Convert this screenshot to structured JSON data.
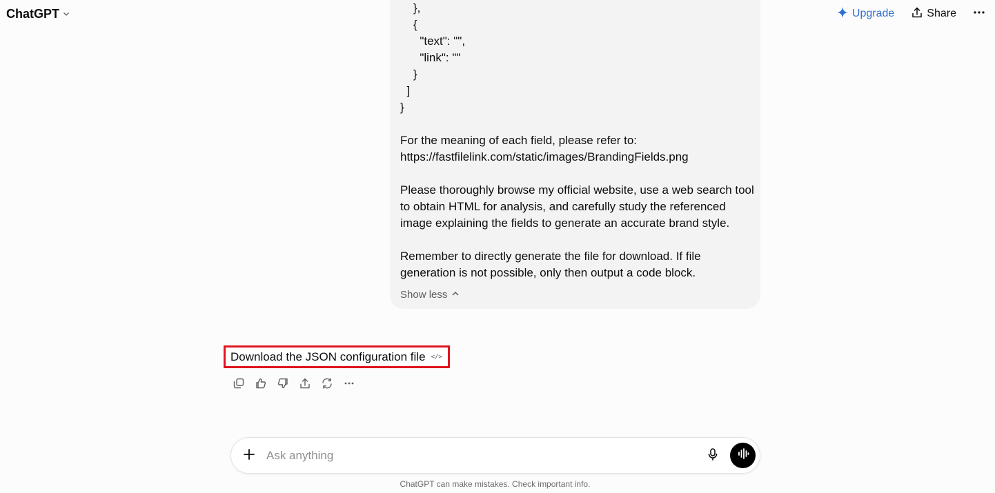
{
  "header": {
    "title": "ChatGPT",
    "upgrade_label": "Upgrade",
    "share_label": "Share"
  },
  "user_message": {
    "code_lines": [
      "    },",
      "    {",
      "      \"text\": \"\",",
      "      \"link\": \"\"",
      "    }",
      "  ]",
      "}"
    ],
    "paragraphs": [
      [
        "For the meaning of each field, please refer to:",
        "https://fastfilelink.com/static/images/BrandingFields.png"
      ],
      [
        "Please thoroughly browse my official website, use a web search tool",
        "to obtain HTML for analysis, and carefully study the referenced",
        "image explaining the fields to generate an accurate brand style."
      ],
      [
        "Remember to directly generate the file for download. If file",
        "generation is not possible, only then output a code block."
      ]
    ],
    "show_less_label": "Show less"
  },
  "assistant_message": {
    "download_link_text": "Download the JSON configuration file",
    "code_badge": "</>"
  },
  "composer": {
    "placeholder": "Ask anything"
  },
  "footer": {
    "disclaimer": "ChatGPT can make mistakes. Check important info."
  },
  "colors": {
    "accent": "#2f6fd6",
    "highlight_border": "#e0141e",
    "bubble_bg": "#f3f3f3"
  },
  "icons": [
    "chevron-down-icon",
    "sparkle-icon",
    "share-icon",
    "more-icon",
    "chevron-up-icon",
    "copy-icon",
    "thumbs-up-icon",
    "thumbs-down-icon",
    "share-icon",
    "regenerate-icon",
    "more-icon",
    "plus-icon",
    "mic-icon",
    "voice-mode-icon"
  ]
}
